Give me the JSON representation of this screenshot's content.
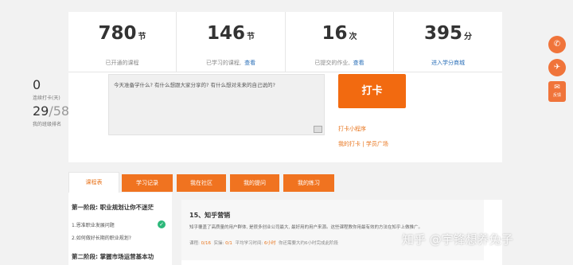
{
  "stats": [
    {
      "num": "780",
      "unit": "节",
      "label": "已开通的课程",
      "link": ""
    },
    {
      "num": "146",
      "unit": "节",
      "label": "已学习的课程,",
      "link": "查看"
    },
    {
      "num": "16",
      "unit": "次",
      "label": "已提交的作业,",
      "link": "查看"
    },
    {
      "num": "395",
      "unit": "分",
      "label": "",
      "link": "进入学分商城"
    }
  ],
  "checkin": {
    "days": "0",
    "days_label": "连续打卡(天)",
    "rank": "29",
    "rank_sep": "/",
    "rank_total": "58",
    "rank_label": "我的班级排名",
    "placeholder": "今天准备学什么? 有什么想跟大家分享的? 有什么想对未来的自己说的?",
    "button": "打卡",
    "mini_program": "打卡小程序",
    "my_checkin": "我的打卡",
    "divider": "|",
    "square": "学员广场"
  },
  "side_buttons": [
    {
      "glyph": "✆",
      "label": ""
    },
    {
      "glyph": "✈",
      "label": ""
    },
    {
      "glyph": "✉",
      "label": "反馈"
    }
  ],
  "tabs": [
    "课程表",
    "学习记录",
    "我在社区",
    "我的提问",
    "我的练习"
  ],
  "syllabus": {
    "phase1": "第一阶段: 职业规划让你不迷茫",
    "lessons": [
      "1.恩准职业发展问题",
      "2.如何做好长期的职业规划?"
    ],
    "phase2": "第二阶段: 掌握市场运营基本功"
  },
  "lesson_detail": {
    "title": "15、知乎营销",
    "desc": "知乎覆盖了高质量的用户群体, 是很多创业公司最大, 最好用的用户来源。这些课程教你用最有效的方法在知乎上做推广。",
    "meta_course_label": "课程:",
    "meta_course": "0/16",
    "meta_practice_label": "实操:",
    "meta_practice": "0/1",
    "meta_time_label": "平均学习时间:",
    "meta_time": "6小时",
    "meta_note": "你还需要大约6小时完成此阶段"
  },
  "watermark": "知乎 @宇锋想养兔子",
  "colors": {
    "accent": "#f07320",
    "link": "#2a6fb8",
    "success": "#2cb87a"
  }
}
